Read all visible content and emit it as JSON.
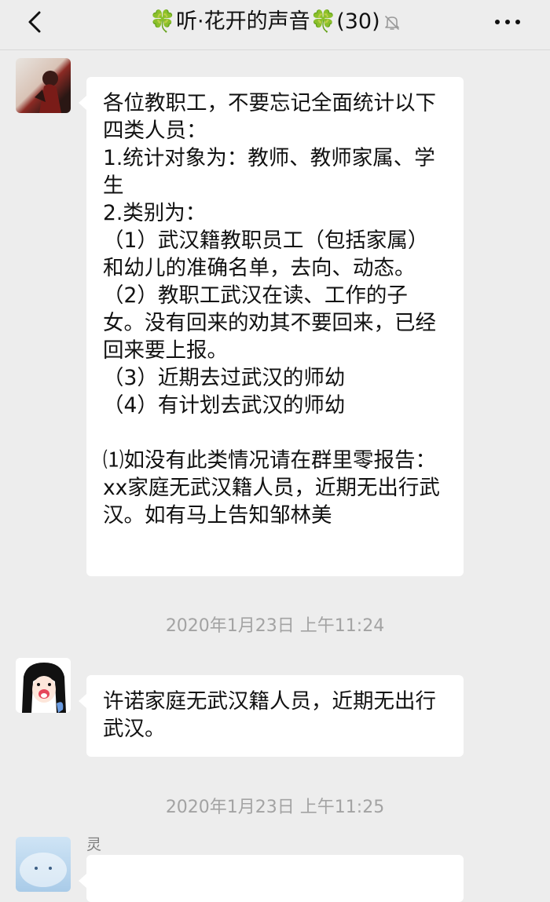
{
  "header": {
    "title_prefix_icon": "🍀",
    "title_text": "听·花开的声音",
    "title_suffix_icon": "🍀",
    "member_count": "(30)",
    "muted_icon": "bell-off-icon"
  },
  "messages": [
    {
      "avatar": "user-avatar",
      "name": "",
      "text": "各位教职工，不要忘记全面统计以下四类人员：\n1.统计对象为：教师、教师家属、学生\n2.类别为：\n（1）武汉籍教职员工（包括家属）和幼儿的准确名单，去向、动态。\n（2）教职工武汉在读、工作的子女。没有回来的劝其不要回来，已经回来要上报。\n（3）近期去过武汉的师幼\n（4）有计划去武汉的师幼\n\n⑴如没有此类情况请在群里零报告：xx家庭无武汉籍人员，近期无出行武汉。如有马上告知邹林美"
    },
    {
      "avatar": "user-avatar",
      "name": "",
      "text": "许诺家庭无武汉籍人员，近期无出行武汉。"
    },
    {
      "avatar": "user-avatar",
      "name": "灵",
      "text": ""
    }
  ],
  "timestamps": [
    "2020年1月23日 上午11:24",
    "2020年1月23日 上午11:25"
  ]
}
